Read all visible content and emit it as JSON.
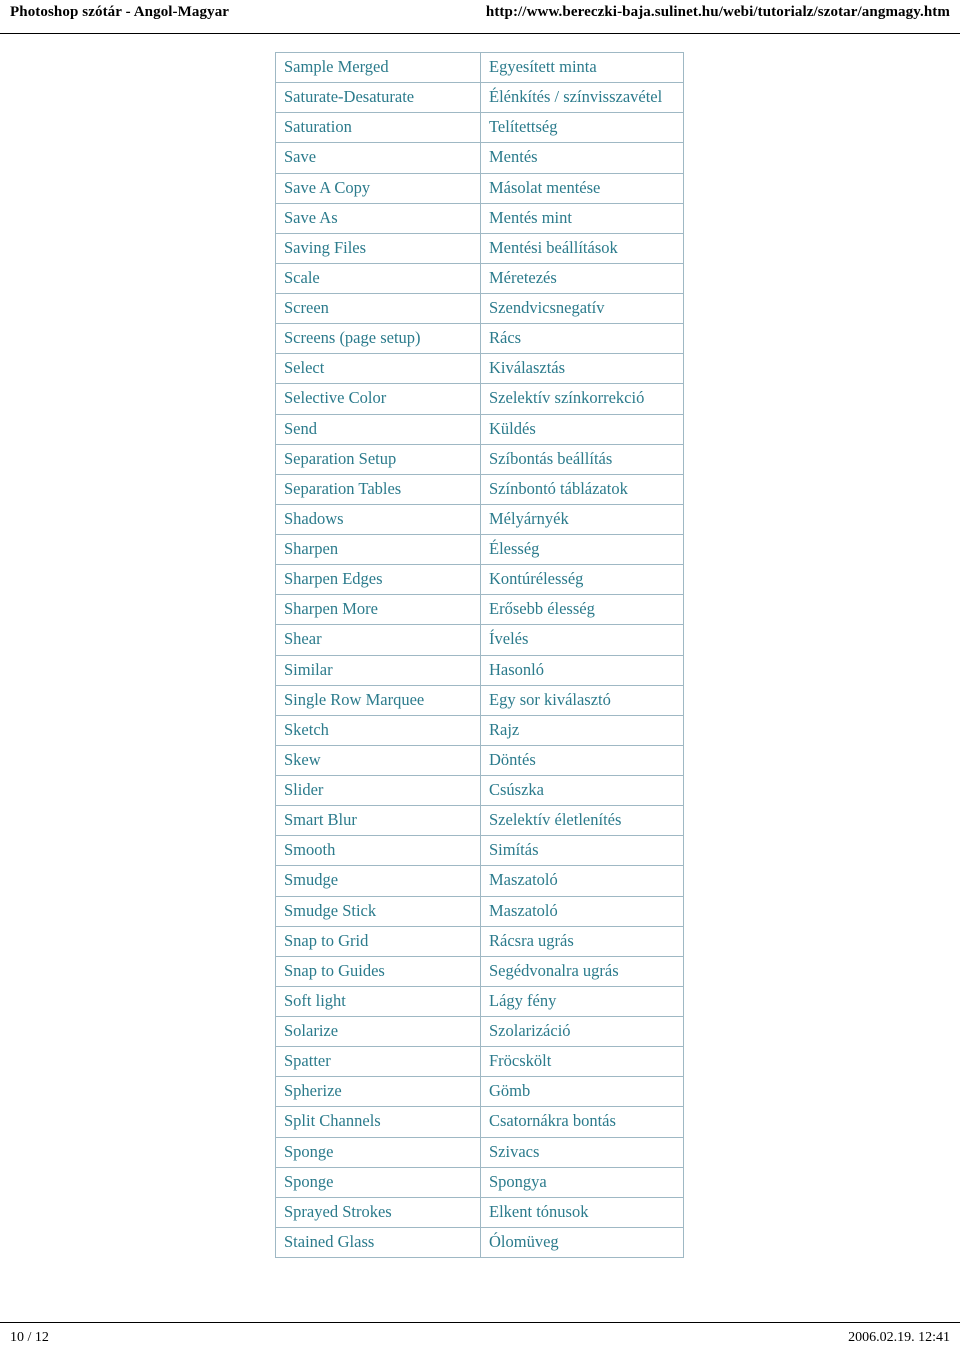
{
  "header": {
    "left_title": "Photoshop szótár - Angol-Magyar",
    "right_url": "http://www.bereczki-baja.sulinet.hu/webi/tutorialz/szotar/angmagy.htm"
  },
  "footer": {
    "page_number": "10 / 12",
    "timestamp": "2006.02.19. 12:41"
  },
  "glossary": {
    "rows": [
      {
        "en": "Sample Merged",
        "hu": "Egyesített minta"
      },
      {
        "en": "Saturate-Desaturate",
        "hu": "Élénkítés / színvisszavétel"
      },
      {
        "en": "Saturation",
        "hu": "Telítettség"
      },
      {
        "en": "Save",
        "hu": "Mentés"
      },
      {
        "en": "Save A Copy",
        "hu": "Másolat mentése"
      },
      {
        "en": "Save As",
        "hu": "Mentés mint"
      },
      {
        "en": "Saving Files",
        "hu": "Mentési beállítások"
      },
      {
        "en": "Scale",
        "hu": "Méretezés"
      },
      {
        "en": "Screen",
        "hu": "Szendvicsnegatív"
      },
      {
        "en": "Screens (page setup)",
        "hu": "Rács"
      },
      {
        "en": "Select",
        "hu": "Kiválasztás"
      },
      {
        "en": "Selective Color",
        "hu": "Szelektív színkorrekció"
      },
      {
        "en": "Send",
        "hu": "Küldés"
      },
      {
        "en": "Separation Setup",
        "hu": "Szíbontás beállítás"
      },
      {
        "en": "Separation Tables",
        "hu": "Színbontó táblázatok"
      },
      {
        "en": "Shadows",
        "hu": "Mélyárnyék"
      },
      {
        "en": "Sharpen",
        "hu": "Élesség"
      },
      {
        "en": "Sharpen Edges",
        "hu": "Kontúrélesség"
      },
      {
        "en": "Sharpen More",
        "hu": "Erősebb élesség"
      },
      {
        "en": "Shear",
        "hu": "Ívelés"
      },
      {
        "en": "Similar",
        "hu": "Hasonló"
      },
      {
        "en": "Single Row Marquee",
        "hu": "Egy sor kiválasztó"
      },
      {
        "en": "Sketch",
        "hu": "Rajz"
      },
      {
        "en": "Skew",
        "hu": "Döntés"
      },
      {
        "en": "Slider",
        "hu": "Csúszka"
      },
      {
        "en": "Smart Blur",
        "hu": "Szelektív életlenítés"
      },
      {
        "en": "Smooth",
        "hu": "Simítás"
      },
      {
        "en": "Smudge",
        "hu": "Maszatoló"
      },
      {
        "en": "Smudge Stick",
        "hu": "Maszatoló"
      },
      {
        "en": "Snap to Grid",
        "hu": "Rácsra ugrás"
      },
      {
        "en": "Snap to Guides",
        "hu": "Segédvonalra ugrás"
      },
      {
        "en": "Soft light",
        "hu": "Lágy fény"
      },
      {
        "en": "Solarize",
        "hu": "Szolarizáció"
      },
      {
        "en": "Spatter",
        "hu": "Fröcskölt"
      },
      {
        "en": "Spherize",
        "hu": "Gömb"
      },
      {
        "en": "Split Channels",
        "hu": "Csatornákra bontás"
      },
      {
        "en": "Sponge",
        "hu": "Szivacs"
      },
      {
        "en": "Sponge",
        "hu": "Spongya"
      },
      {
        "en": "Sprayed Strokes",
        "hu": "Elkent tónusok"
      },
      {
        "en": "Stained Glass",
        "hu": "Ólomüveg"
      }
    ]
  }
}
